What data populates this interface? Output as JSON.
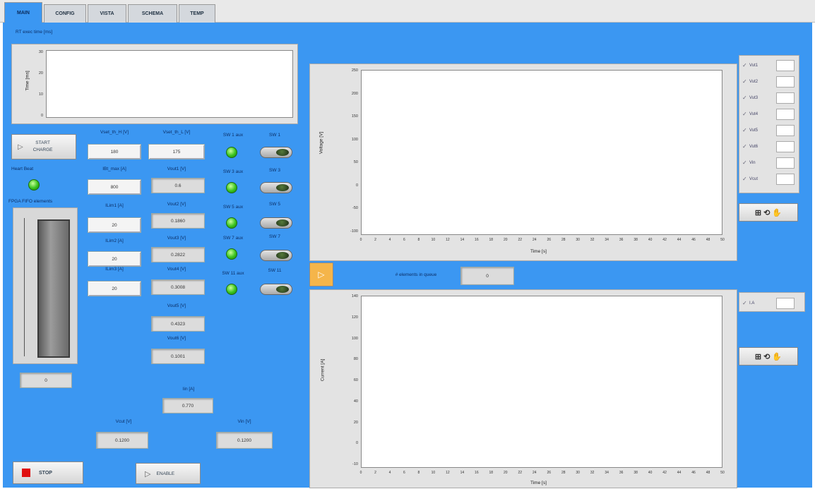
{
  "tabs": [
    "MAIN",
    "CONFIG",
    "VISTA",
    "SCHEMA",
    "TEMP"
  ],
  "active_tab": "MAIN",
  "colors": {
    "panel": "#3b97f2",
    "led": "#38c21d",
    "stop": "#e01010"
  },
  "rt": {
    "title": "RT exec time [ms]",
    "ylabel": "Time [ms]",
    "yticks": [
      "30",
      "20",
      "10",
      "0"
    ]
  },
  "start_charge": {
    "line1": "START",
    "line2": "CHARGE"
  },
  "heartbeat": "Heart Beat",
  "fifo": {
    "label": "FPGA FIFO elements",
    "value": "0"
  },
  "fields": {
    "vset_h": {
      "label": "Vset_th_H [V]",
      "value": "180"
    },
    "vset_l": {
      "label": "Vset_th_L [V]",
      "value": "175"
    },
    "ibt_max": {
      "label": "IBt_max [A]",
      "value": "800"
    },
    "ilim1": {
      "label": "ILim1 [A]",
      "value": "20"
    },
    "ilim2": {
      "label": "ILim2 [A]",
      "value": "20"
    },
    "ilim3": {
      "label": "ILim3 [A]",
      "value": "20"
    }
  },
  "readouts": [
    {
      "label": "Vout1 [V]",
      "value": "0.6"
    },
    {
      "label": "Vout2 [V]",
      "value": "0.1860"
    },
    {
      "label": "Vout3 [V]",
      "value": "0.2822"
    },
    {
      "label": "Vout4 [V]",
      "value": "0.3008"
    },
    {
      "label": "Vout5 [V]",
      "value": "0.4323"
    },
    {
      "label": "Vout6 [V]",
      "value": "0.1001"
    }
  ],
  "switches": [
    {
      "led_label": "SW 1 aux",
      "sw_label": "SW 1"
    },
    {
      "led_label": "SW 3 aux",
      "sw_label": "SW 3"
    },
    {
      "led_label": "SW 5 aux",
      "sw_label": "SW 5"
    },
    {
      "led_label": "SW 7 aux",
      "sw_label": "SW 7"
    },
    {
      "led_label": "SW 11 aux",
      "sw_label": "SW 11"
    }
  ],
  "iin": {
    "label": "Iin [A]",
    "value": "0.770"
  },
  "vcut": {
    "label": "Vcut [V]",
    "value": "0.1200"
  },
  "vin": {
    "label": "Vin [V]",
    "value": "0.1200"
  },
  "stop_label": "STOP",
  "enable_label": "ENABLE",
  "voltage_chart": {
    "ylabel": "Voltage [V]",
    "xlabel": "Time [s]",
    "yticks": [
      "250",
      "200",
      "150",
      "100",
      "50",
      "0",
      "-50",
      "-100"
    ],
    "xticks": [
      "0",
      "2",
      "4",
      "6",
      "8",
      "10",
      "12",
      "14",
      "16",
      "18",
      "20",
      "22",
      "24",
      "26",
      "28",
      "30",
      "32",
      "34",
      "36",
      "38",
      "40",
      "42",
      "44",
      "46",
      "48",
      "50"
    ],
    "legend": [
      "Vut1",
      "Vut2",
      "Vut3",
      "Vut4",
      "Vut5",
      "Vut6",
      "Vin",
      "Vcut"
    ]
  },
  "queue": {
    "label": "# elements in queue",
    "value": "0"
  },
  "current_chart": {
    "ylabel": "Current [A]",
    "xlabel": "Time [s]",
    "yticks": [
      "140",
      "120",
      "100",
      "80",
      "60",
      "40",
      "20",
      "0",
      "-10"
    ],
    "xticks": [
      "0",
      "2",
      "4",
      "6",
      "8",
      "10",
      "12",
      "14",
      "16",
      "18",
      "20",
      "22",
      "24",
      "26",
      "28",
      "30",
      "32",
      "34",
      "36",
      "38",
      "40",
      "42",
      "44",
      "46",
      "48",
      "50"
    ],
    "legend": [
      "I.A"
    ]
  },
  "tool_glyph": "⊞ ⟲ ✋"
}
